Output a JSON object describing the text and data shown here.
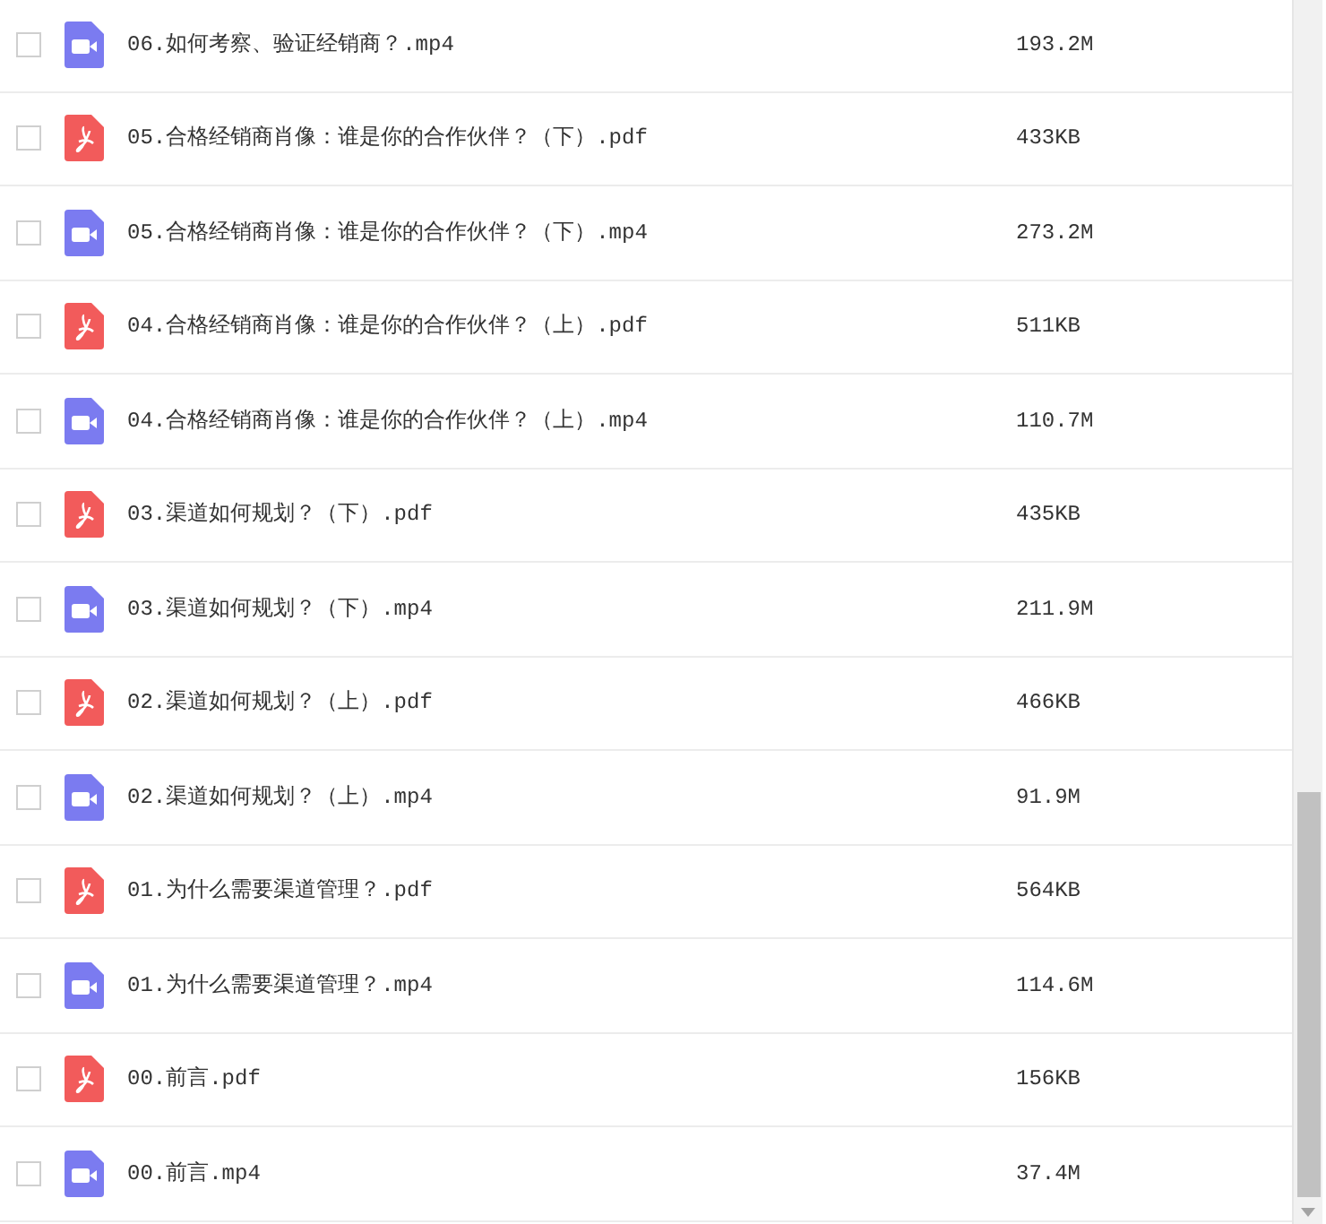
{
  "files": [
    {
      "kind": "video",
      "name": "06.如何考察、验证经销商？.mp4",
      "size": "193.2M",
      "checked": false
    },
    {
      "kind": "pdf",
      "name": "05.合格经销商肖像：谁是你的合作伙伴？（下）.pdf",
      "size": "433KB",
      "checked": false
    },
    {
      "kind": "video",
      "name": "05.合格经销商肖像：谁是你的合作伙伴？（下）.mp4",
      "size": "273.2M",
      "checked": false
    },
    {
      "kind": "pdf",
      "name": "04.合格经销商肖像：谁是你的合作伙伴？（上）.pdf",
      "size": "511KB",
      "checked": false
    },
    {
      "kind": "video",
      "name": "04.合格经销商肖像：谁是你的合作伙伴？（上）.mp4",
      "size": "110.7M",
      "checked": false
    },
    {
      "kind": "pdf",
      "name": "03.渠道如何规划？（下）.pdf",
      "size": "435KB",
      "checked": false
    },
    {
      "kind": "video",
      "name": "03.渠道如何规划？（下）.mp4",
      "size": "211.9M",
      "checked": false
    },
    {
      "kind": "pdf",
      "name": "02.渠道如何规划？（上）.pdf",
      "size": "466KB",
      "checked": false
    },
    {
      "kind": "video",
      "name": "02.渠道如何规划？（上）.mp4",
      "size": "91.9M",
      "checked": false
    },
    {
      "kind": "pdf",
      "name": "01.为什么需要渠道管理？.pdf",
      "size": "564KB",
      "checked": false
    },
    {
      "kind": "video",
      "name": "01.为什么需要渠道管理？.mp4",
      "size": "114.6M",
      "checked": false
    },
    {
      "kind": "pdf",
      "name": "00.前言.pdf",
      "size": "156KB",
      "checked": false
    },
    {
      "kind": "video",
      "name": "00.前言.mp4",
      "size": "37.4M",
      "checked": false
    }
  ]
}
